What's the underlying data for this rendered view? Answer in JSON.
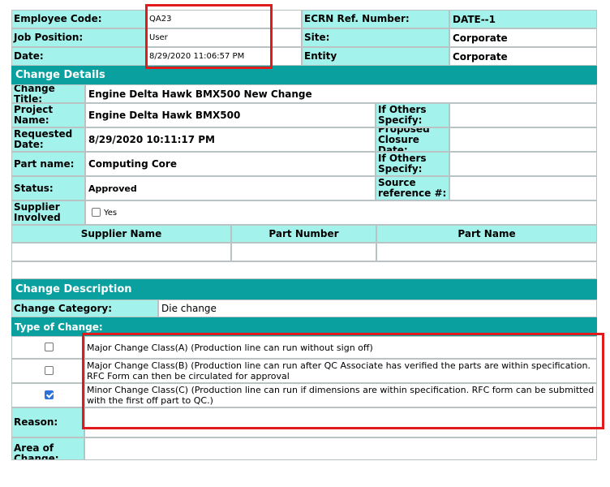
{
  "employee": {
    "code_label": "Employee Code:",
    "code_value": "QA23",
    "ecrn_label": "ECRN Ref. Number:",
    "ecrn_value": "DATE--1",
    "position_label": "Job Position:",
    "position_value": "User",
    "site_label": "Site:",
    "site_value": "Corporate",
    "date_label": "Date:",
    "date_value": "8/29/2020 11:06:57 PM",
    "entity_label": "Entity",
    "entity_value": "Corporate"
  },
  "change_details": {
    "header": "Change Details",
    "title_label": "Change Title:",
    "title_value": "Engine Delta Hawk BMX500 New Change",
    "project_label": "Project Name:",
    "project_value": "Engine Delta Hawk BMX500",
    "if_others_label": "If Others Specify:",
    "requested_label": "Requested Date:",
    "requested_value": "8/29/2020 10:11:17 PM",
    "proposed_label": "Proposed Closure Date:",
    "part_label": "Part name:",
    "part_value": "Computing Core",
    "status_label": "Status:",
    "status_value": "Approved",
    "source_label": "Source reference #:",
    "supplier_label": "Supplier Involved",
    "supplier_yes": "Yes"
  },
  "supplier_table": {
    "columns": [
      "Supplier Name",
      "Part Number",
      "Part Name"
    ]
  },
  "change_description": {
    "header": "Change Description",
    "category_label": "Change Category:",
    "category_value": "Die change",
    "type_label": "Type of Change:",
    "options": [
      {
        "label": "Major Change Class(A) (Production line can run without sign off)",
        "checked": false
      },
      {
        "label": "Major Change Class(B) (Production line can run after QC Associate has verified the parts are within specification. RFC Form can then be circulated for approval",
        "checked": false
      },
      {
        "label": "Minor Change Class(C) (Production line can run if dimensions are within specification. RFC form can be submitted with the first off part to QC.)",
        "checked": true
      }
    ],
    "reason_label": "Reason:",
    "area_label": "Area of Change:"
  }
}
